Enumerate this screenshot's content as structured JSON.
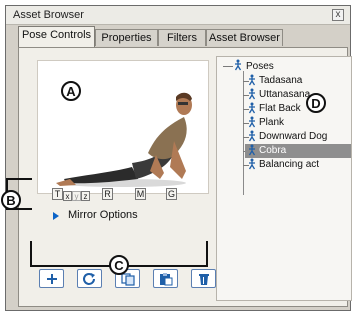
{
  "window": {
    "title": "Asset Browser",
    "close_glyph": "x"
  },
  "tabs": [
    {
      "label": "Pose Controls",
      "active": true
    },
    {
      "label": "Properties",
      "active": false
    },
    {
      "label": "Filters",
      "active": false
    },
    {
      "label": "Asset Browser",
      "active": false
    }
  ],
  "callouts": {
    "a": "A",
    "b": "B",
    "c": "C",
    "d": "D"
  },
  "axis_buttons": [
    {
      "label": "T"
    },
    {
      "label": "x"
    },
    {
      "label": "y"
    },
    {
      "label": "z"
    },
    {
      "label": "R"
    },
    {
      "label": "M"
    },
    {
      "label": "G"
    }
  ],
  "mirror": {
    "label": "Mirror Options",
    "icon": "triangle-right-icon"
  },
  "actions": [
    {
      "name": "add",
      "icon": "plus-icon"
    },
    {
      "name": "refresh",
      "icon": "refresh-icon"
    },
    {
      "name": "copy",
      "icon": "copy-icon"
    },
    {
      "name": "paste",
      "icon": "paste-icon"
    },
    {
      "name": "delete",
      "icon": "trash-icon"
    }
  ],
  "tree": {
    "root": "Poses",
    "items": [
      "Tadasana",
      "Uttanasana",
      "Flat Back",
      "Plank",
      "Downward Dog",
      "Cobra",
      "Balancing act"
    ],
    "selected": "Cobra"
  },
  "colors": {
    "accent": "#0b63c7",
    "selection": "#8e8e8e",
    "panel": "#f1efe9"
  }
}
